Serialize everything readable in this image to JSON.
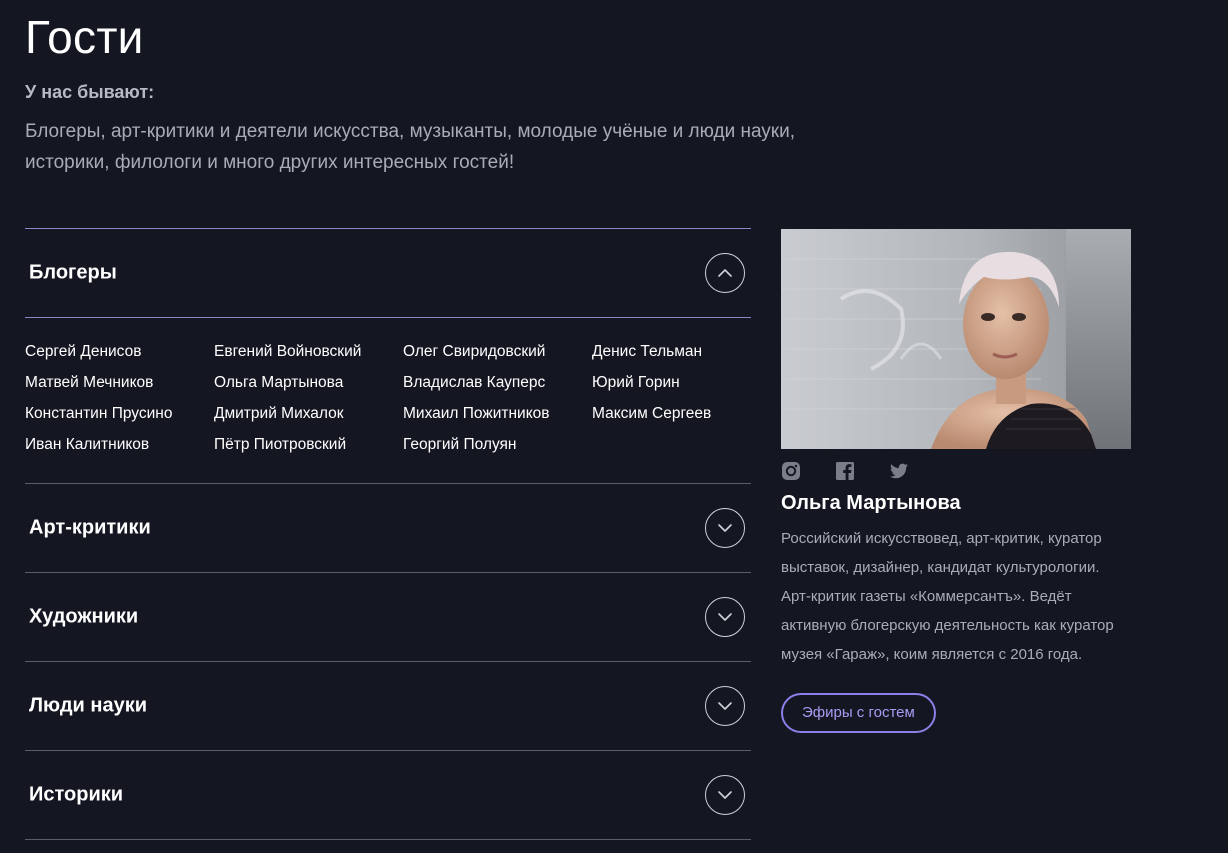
{
  "page": {
    "title": "Гости",
    "subtitle": "У нас бывают:",
    "intro": "Блогеры, арт-критики и деятели искусства, музыканты, молодые учёные и люди науки, историки, филологи и много других интересных гостей!"
  },
  "accordion": {
    "open": {
      "title": "Блогеры",
      "toggle_icon": "chevron-up-icon",
      "names": [
        "Сергей Денисов",
        "Евгений Войновский",
        "Олег Свиридовский",
        "Денис Тельман",
        "Матвей Мечников",
        "Ольга Мартынова",
        "Владислав Кауперс",
        "Юрий Горин",
        "Константин Прусино",
        "Дмитрий Михалок",
        "Михаил Пожитников",
        "Максим Сергеев",
        "Иван Калитников",
        "Пётр Пиотровский",
        "Георгий Полуян"
      ]
    },
    "closed": [
      {
        "title": "Арт-критики",
        "toggle_icon": "chevron-down-icon"
      },
      {
        "title": "Художники",
        "toggle_icon": "chevron-down-icon"
      },
      {
        "title": "Люди науки",
        "toggle_icon": "chevron-down-icon"
      },
      {
        "title": "Историки",
        "toggle_icon": "chevron-down-icon"
      }
    ]
  },
  "profile": {
    "photo_icon": "guest-portrait-photo",
    "socials": [
      "instagram-icon",
      "facebook-icon",
      "twitter-icon"
    ],
    "name": "Ольга Мартынова",
    "bio": "Российский искусствовед, арт-критик, куратор выставок, дизайнер, кандидат культурологии. Арт-критик газеты «Коммерсантъ». Ведёт активную блогерскую деятельность как куратор музея «Гараж», коим является с 2016 года.",
    "button_label": "Эфиры с гостем"
  },
  "colors": {
    "background": "#141722",
    "accent": "#8b7fe8",
    "divider": "#5b5e6a",
    "muted_text": "#a9acb8"
  }
}
